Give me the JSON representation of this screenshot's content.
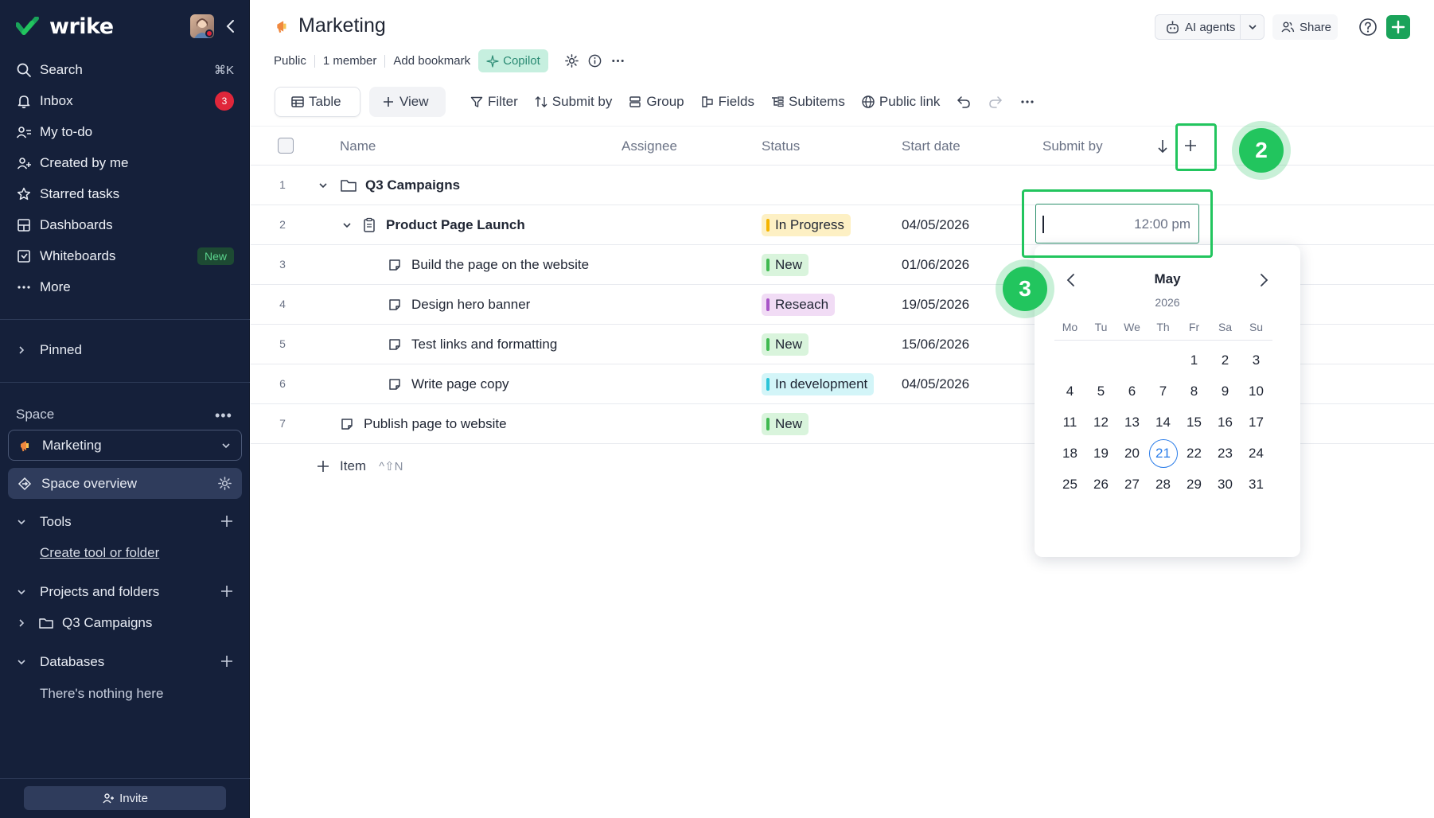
{
  "app": {
    "logo_text": "wrike"
  },
  "sidebar": {
    "nav": [
      {
        "label": "Search",
        "shortcut": "⌘K"
      },
      {
        "label": "Inbox",
        "badge": "3"
      },
      {
        "label": "My to-do"
      },
      {
        "label": "Created by me"
      },
      {
        "label": "Starred tasks"
      },
      {
        "label": "Dashboards"
      },
      {
        "label": "Whiteboards",
        "badge": "New"
      },
      {
        "label": "More"
      }
    ],
    "pinned": "Pinned",
    "space_label": "Space",
    "space_more": "•••",
    "space_name": "Marketing",
    "space_overview": "Space overview",
    "tools": {
      "label": "Tools",
      "link": "Create tool or folder"
    },
    "projects": {
      "label": "Projects and folders",
      "item": "Q3 Campaigns"
    },
    "databases": {
      "label": "Databases",
      "empty": "There's nothing here"
    },
    "invite": "Invite"
  },
  "header": {
    "title": "Marketing",
    "meta": {
      "visibility": "Public",
      "members": "1 member",
      "bookmark": "Add bookmark",
      "copilot": "Copilot"
    },
    "ai_agents": "AI agents",
    "share": "Share"
  },
  "toolbar": {
    "table": "Table",
    "view": "View",
    "filter": "Filter",
    "sort": "Submit by",
    "group": "Group",
    "fields": "Fields",
    "subitems": "Subitems",
    "public_link": "Public link"
  },
  "table": {
    "columns": {
      "name": "Name",
      "assignee": "Assignee",
      "status": "Status",
      "start": "Start date",
      "submit": "Submit by"
    },
    "rows": [
      {
        "num": "1",
        "name": "Q3 Campaigns",
        "status": "",
        "start": ""
      },
      {
        "num": "2",
        "name": "Product Page Launch",
        "status": "In Progress",
        "start": "04/05/2026"
      },
      {
        "num": "3",
        "name": "Build the page on the website",
        "status": "New",
        "start": "01/06/2026"
      },
      {
        "num": "4",
        "name": "Design hero banner",
        "status": "Reseach",
        "start": "19/05/2026"
      },
      {
        "num": "5",
        "name": "Test links and formatting",
        "status": "New",
        "start": "15/06/2026"
      },
      {
        "num": "6",
        "name": "Write page copy",
        "status": "In development",
        "start": "04/05/2026"
      },
      {
        "num": "7",
        "name": "Publish page to website",
        "status": "New",
        "start": ""
      }
    ],
    "add_item": "Item",
    "add_item_shortcut": "^⇧N"
  },
  "date_editor": {
    "time": "12:00 pm",
    "month": "May",
    "year": "2026",
    "weekdays": [
      "Mo",
      "Tu",
      "We",
      "Th",
      "Fr",
      "Sa",
      "Su"
    ],
    "days": [
      "",
      "",
      "",
      "",
      "1",
      "2",
      "3",
      "4",
      "5",
      "6",
      "7",
      "8",
      "9",
      "10",
      "11",
      "12",
      "13",
      "14",
      "15",
      "16",
      "17",
      "18",
      "19",
      "20",
      "21",
      "22",
      "23",
      "24",
      "25",
      "26",
      "27",
      "28",
      "29",
      "30",
      "31"
    ],
    "today": "21"
  },
  "annotations": {
    "marker_2": "2",
    "marker_3": "3"
  },
  "colors": {
    "sidebar_bg": "#15203a",
    "accent_green": "#1aa35a",
    "highlight": "#22c55e",
    "status_in_progress": "#f5b400",
    "status_new": "#3fb950",
    "status_research": "#a855c8",
    "status_in_development": "#2bc4d8"
  }
}
